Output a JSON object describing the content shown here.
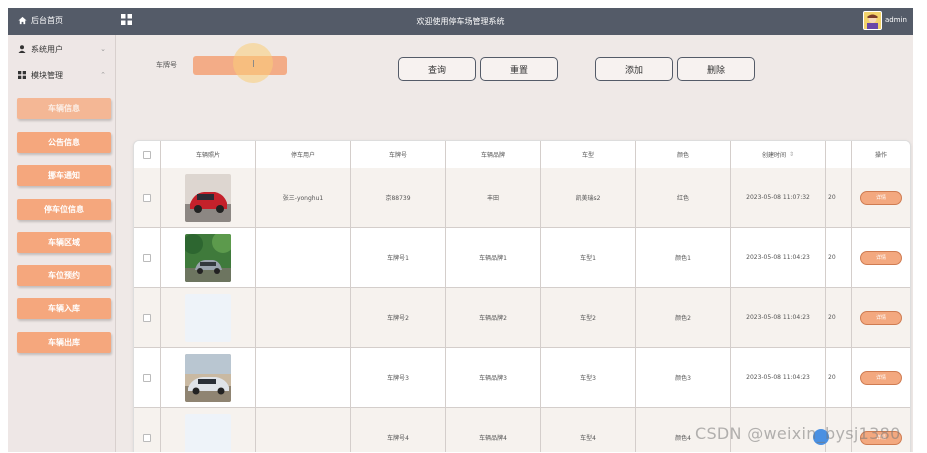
{
  "topbar": {
    "home_label": "后台首页",
    "title": "欢迎使用停车场管理系统",
    "username": "admin"
  },
  "sidebar": {
    "groups": [
      {
        "label": "系统用户",
        "icon": "user-icon"
      },
      {
        "label": "模块管理",
        "icon": "grid-icon"
      }
    ],
    "items": [
      {
        "label": "车辆信息"
      },
      {
        "label": "公告信息"
      },
      {
        "label": "挪车通知"
      },
      {
        "label": "停车位信息"
      },
      {
        "label": "车辆区域"
      },
      {
        "label": "车位预约"
      },
      {
        "label": "车辆入库"
      },
      {
        "label": "车辆出库"
      }
    ]
  },
  "search": {
    "label": "车牌号",
    "placeholder": "",
    "value": ""
  },
  "toolbar": {
    "query_label": "查询",
    "reset_label": "重置",
    "add_label": "添加",
    "delete_label": "删除"
  },
  "table": {
    "headers": [
      "车辆照片",
      "停车用户",
      "车牌号",
      "车辆品牌",
      "车型",
      "颜色",
      "创建时间",
      "",
      "操作"
    ],
    "sort_icon": "sort-icon",
    "rows": [
      {
        "photo": "red-car",
        "user": "张三-yonghu1",
        "plate": "京88739",
        "brand": "丰田",
        "model": "凯美瑞s2",
        "color": "红色",
        "created": "2023-05-08 11:07:32",
        "extra": "20",
        "action": "详情"
      },
      {
        "photo": "forest-car",
        "user": "",
        "plate": "车牌号1",
        "brand": "车辆品牌1",
        "model": "车型1",
        "color": "颜色1",
        "created": "2023-05-08 11:04:23",
        "extra": "20",
        "action": "详情"
      },
      {
        "photo": "blank",
        "user": "",
        "plate": "车牌号2",
        "brand": "车辆品牌2",
        "model": "车型2",
        "color": "颜色2",
        "created": "2023-05-08 11:04:23",
        "extra": "20",
        "action": "详情"
      },
      {
        "photo": "silver-car",
        "user": "",
        "plate": "车牌号3",
        "brand": "车辆品牌3",
        "model": "车型3",
        "color": "颜色3",
        "created": "2023-05-08 11:04:23",
        "extra": "20",
        "action": "详情"
      },
      {
        "photo": "blank",
        "user": "",
        "plate": "车牌号4",
        "brand": "车辆品牌4",
        "model": "车型4",
        "color": "颜色4",
        "created": "",
        "extra": "",
        "action": "详情"
      }
    ]
  },
  "watermark": "CSDN @weixin_bysj1380",
  "colors": {
    "topbar": "#545b68",
    "accent": "#f5a77d",
    "sidebar": "#eee7e6",
    "background": "#efe9e7"
  }
}
